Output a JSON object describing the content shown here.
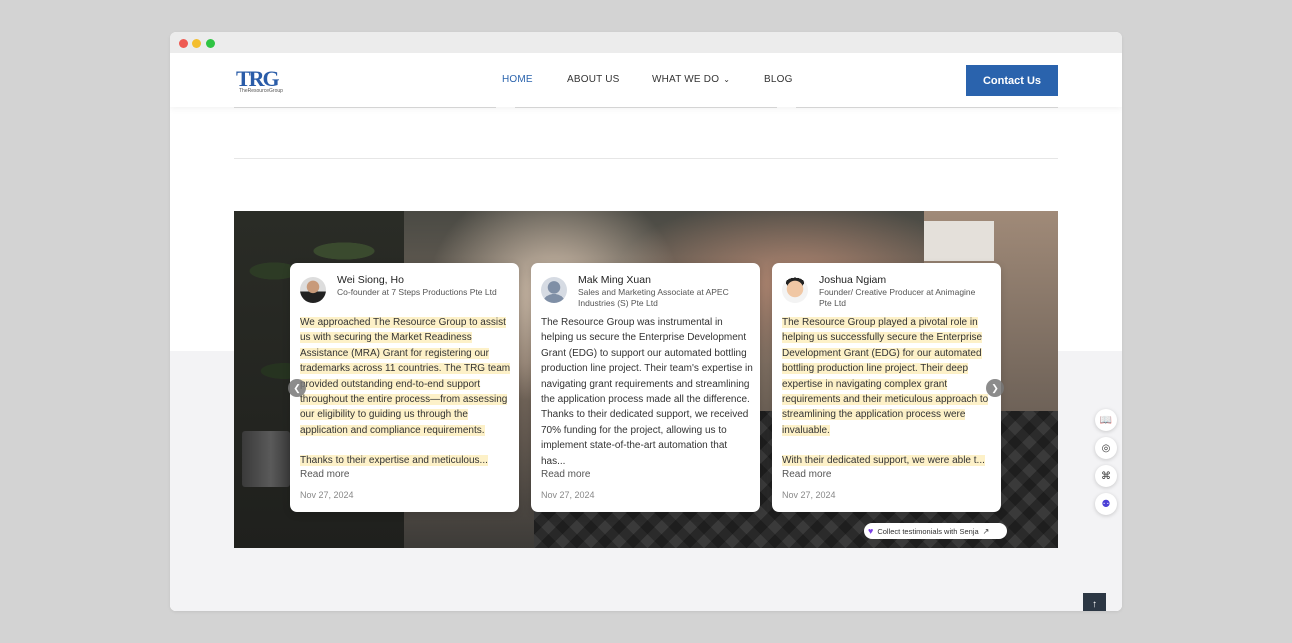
{
  "brand": {
    "logo_text": "TRG",
    "logo_subtext": "TheResourceGroup",
    "accent_color": "#2a63ad"
  },
  "nav": {
    "items": [
      {
        "label": "HOME",
        "active": true
      },
      {
        "label": "ABOUT US",
        "active": false
      },
      {
        "label": "WHAT WE DO",
        "active": false,
        "has_dropdown": true
      },
      {
        "label": "BLOG",
        "active": false
      }
    ],
    "dropdown_icon": "chevron-down-icon",
    "contact_label": "Contact Us"
  },
  "testimonials": [
    {
      "name": "Wei Siong, Ho",
      "role": "Co-founder at 7 Steps Productions Pte Ltd",
      "body": "We approached The Resource Group to assist us with securing the Market Readiness Assistance (MRA) Grant for registering our trademarks across 11 countries. The TRG team provided outstanding end-to-end support throughout the entire process—from assessing our eligibility to guiding us through the application and compliance requirements.",
      "body_highlighted": true,
      "continuation": "Thanks to their expertise and meticulous...",
      "read_more": "Read more",
      "date": "Nov 27, 2024"
    },
    {
      "name": "Mak Ming Xuan",
      "role": "Sales and Marketing Associate at APEC Industries (S) Pte Ltd",
      "body": "The Resource Group was instrumental in helping us secure the Enterprise Development Grant (EDG) to support our automated bottling production line project. Their team's expertise in navigating grant requirements and streamlining the application process made all the difference. Thanks to their dedicated support, we received 70% funding for the project, allowing us to implement state-of-the-art automation that has...",
      "body_highlighted": false,
      "continuation": "",
      "read_more": "Read more",
      "date": "Nov 27, 2024"
    },
    {
      "name": "Joshua Ngiam",
      "role": "Founder/ Creative Producer at Animagine Pte Ltd",
      "body": "The Resource Group played a pivotal role in helping us successfully secure the Enterprise Development Grant (EDG) for our automated bottling production line project. Their deep expertise in navigating complex grant requirements and their meticulous approach to streamlining the application process were invaluable.",
      "body_highlighted": true,
      "continuation": "With their dedicated support, we were able t...",
      "read_more": "Read more",
      "date": "Nov 27, 2024"
    }
  ],
  "carousel": {
    "prev_icon": "chevron-left-icon",
    "next_icon": "chevron-right-icon"
  },
  "senja": {
    "label": "Collect testimonials with Senja",
    "icon": "heart-icon",
    "link_icon": "external-arrow-icon"
  },
  "side_toolbar": [
    {
      "icon": "book-icon"
    },
    {
      "icon": "podcast-icon"
    },
    {
      "icon": "apps-icon"
    },
    {
      "icon": "assistant-face-icon"
    }
  ],
  "back_to_top_icon": "arrow-up-icon"
}
